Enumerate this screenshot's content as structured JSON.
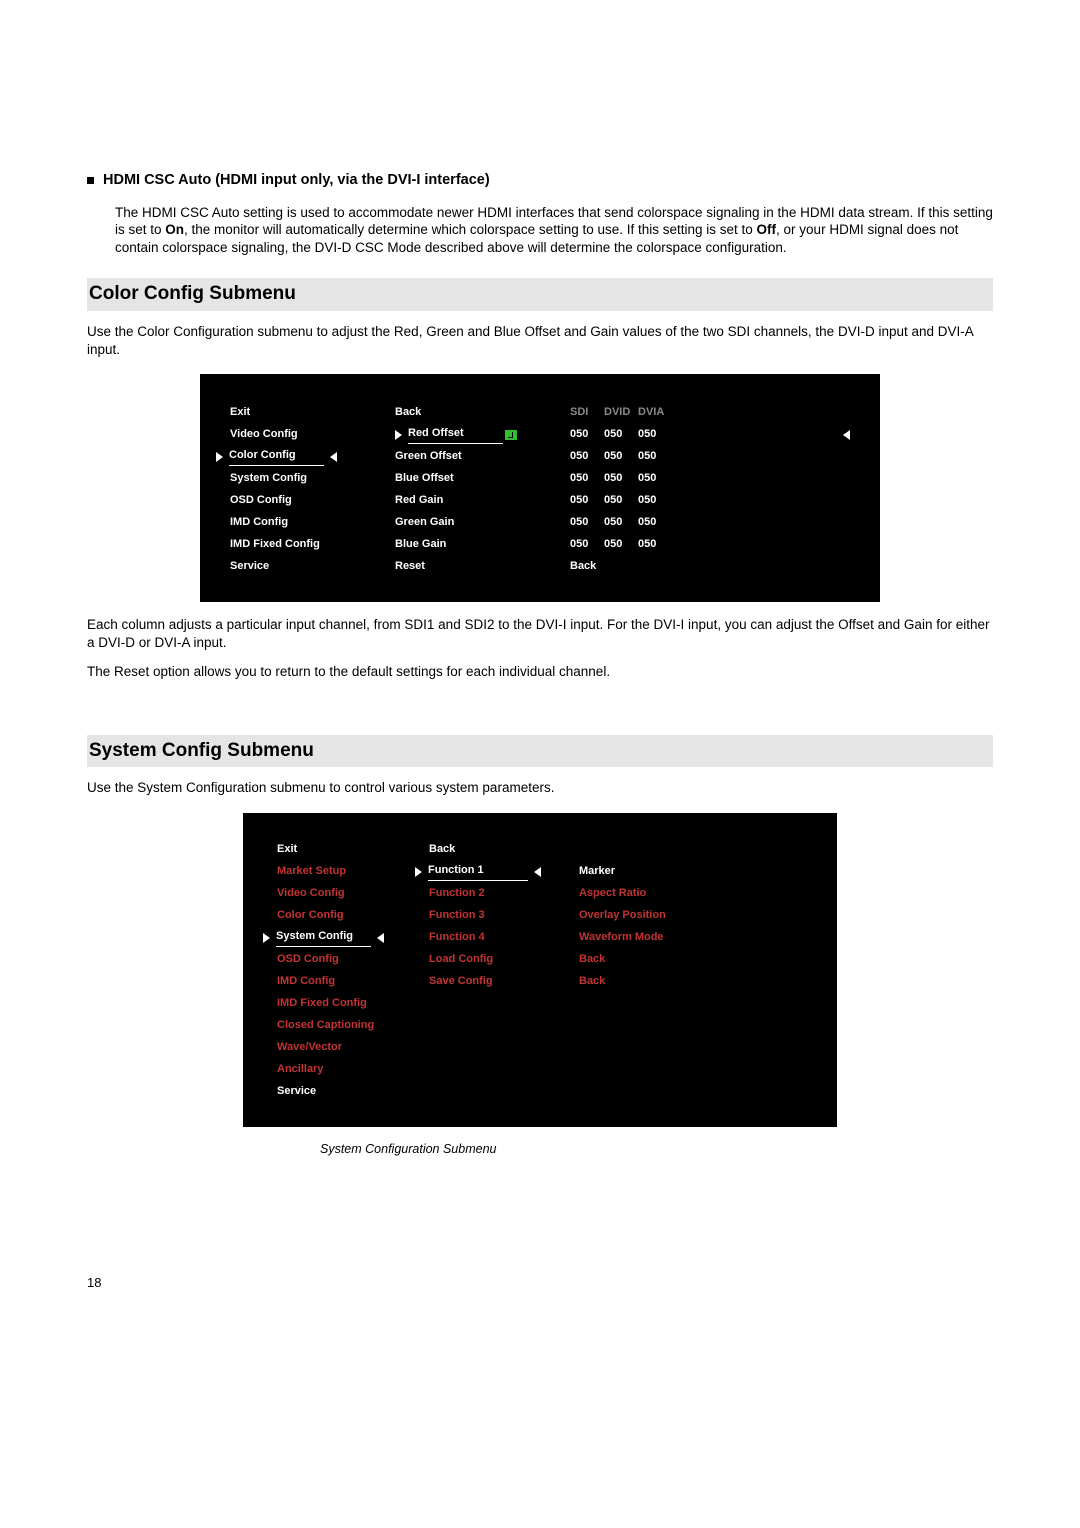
{
  "section_hdmi": {
    "heading": "HDMI CSC Auto (HDMI input only, via the DVI-I interface)",
    "para_pre": "The HDMI CSC Auto setting is used to accommodate newer HDMI interfaces that send colorspace signaling in the HDMI data stream.  If this setting is set to ",
    "bold_on": "On",
    "para_mid": ", the monitor will automatically determine which colorspace setting to use.  If this setting is set to ",
    "bold_off": "Off",
    "para_post": ", or your HDMI signal does not contain colorspace signaling, the DVI-D CSC Mode described above will determine the colorspace configuration."
  },
  "color_config": {
    "heading": "Color Config Submenu",
    "intro": "Use the Color Configuration submenu to adjust the Red, Green and Blue Offset and Gain values of the two SDI channels, the DVI-D input and DVI-A input.",
    "osd": {
      "header": {
        "sdi": "SDI",
        "dvid": "DVID",
        "dvia": "DVIA"
      },
      "left": [
        "Exit",
        "Video Config",
        "Color Config",
        "System Config",
        "OSD Config",
        "IMD Config",
        "IMD Fixed Config",
        "Service"
      ],
      "mid": [
        "Back",
        "Red Offset",
        "Green Offset",
        "Blue Offset",
        "Red Gain",
        "Green Gain",
        "Blue Gain",
        "Reset"
      ],
      "vals": [
        [
          "050",
          "050",
          "050"
        ],
        [
          "050",
          "050",
          "050"
        ],
        [
          "050",
          "050",
          "050"
        ],
        [
          "050",
          "050",
          "050"
        ],
        [
          "050",
          "050",
          "050"
        ],
        [
          "050",
          "050",
          "050"
        ]
      ],
      "reset_label": "Back"
    },
    "para1": "Each column adjusts a particular input channel, from SDI1 and SDI2 to the DVI-I input.  For the DVI-I input, you can adjust the Offset and Gain for either a DVI-D or DVI-A input.",
    "para2": "The Reset option allows you to return to the default settings for each individual channel."
  },
  "system_config": {
    "heading": "System Config Submenu",
    "intro": "Use the System Configuration submenu to control various system parameters.",
    "osd": {
      "left": [
        "Exit",
        "Market Setup",
        "Video Config",
        "Color Config",
        "System Config",
        "OSD Config",
        "IMD Config",
        "IMD Fixed Config",
        "Closed Captioning",
        "Wave/Vector",
        "Ancillary",
        "Service"
      ],
      "mid": [
        "Back",
        "Function 1",
        "Function 2",
        "Function 3",
        "Function 4",
        "Load Config",
        "Save Config"
      ],
      "right": [
        "",
        "Marker",
        "Aspect Ratio",
        "Overlay Position",
        "Waveform Mode",
        "Back",
        "Back"
      ]
    },
    "caption": "System Configuration Submenu"
  },
  "page_number": "18"
}
